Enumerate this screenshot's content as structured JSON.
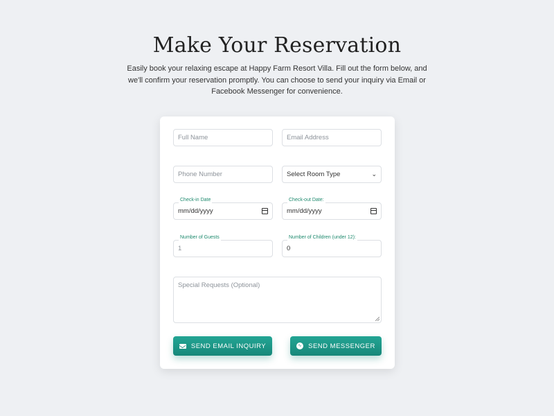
{
  "page": {
    "title": "Make Your Reservation",
    "intro": "Easily book your relaxing escape at Happy Farm Resort Villa. Fill out the form below, and we'll confirm your reservation promptly. You can choose to send your inquiry via Email or Facebook Messenger for convenience."
  },
  "form": {
    "full_name_placeholder": "Full Name",
    "email_placeholder": "Email Address",
    "phone_placeholder": "Phone Number",
    "room_type_value": "Select Room Type",
    "checkin_label": "Check-in Date",
    "checkin_value": "mm/dd/yyyy",
    "checkout_label": "Check-out Date:",
    "checkout_value": "mm/dd/yyyy",
    "guests_label": "Number of Guests",
    "guests_value": "1",
    "children_label": "Number of Children (under 12):",
    "children_value": "0",
    "requests_placeholder": "Special Requests (Optional)"
  },
  "buttons": {
    "email_label": "SEND EMAIL INQUIRY",
    "messenger_label": "SEND MESSENGER"
  },
  "icons": {
    "email": "envelope-icon",
    "messenger": "messenger-icon",
    "calendar": "calendar-icon",
    "dropdown": "chevron-down-icon"
  },
  "colors": {
    "accent": "#1a9484",
    "label": "#1e8a6e",
    "background": "#eef0f3"
  }
}
